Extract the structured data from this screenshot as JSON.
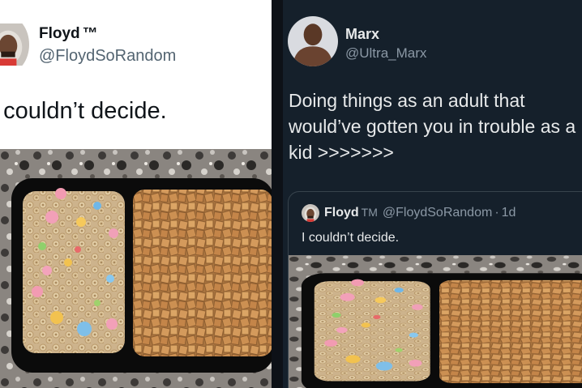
{
  "left_tweet": {
    "name": "Floyd",
    "tm": "™",
    "handle": "@FloydSoRandom",
    "text": "I couldn’t decide."
  },
  "right_tweet": {
    "name": "Marx",
    "handle": "@Ultra_Marx",
    "text": "Doing things as an adult that\nwould’ve gotten you in trouble as a\nkid >>>>>>>",
    "quoted": {
      "name": "Floyd",
      "tm": "TM",
      "handle": "@FloydSoRandom",
      "separator": "·",
      "time": "1d",
      "text": "I couldn’t decide."
    }
  },
  "colors": {
    "dark_bg": "#15202b",
    "light_bg": "#ffffff",
    "primary_text_dark": "#e7e9ea",
    "secondary_text_dark": "#8b98a5",
    "primary_text_light": "#0f1419",
    "secondary_text_light": "#536471"
  },
  "icons": [
    "avatar-floyd",
    "avatar-marx",
    "cereal-photo"
  ]
}
